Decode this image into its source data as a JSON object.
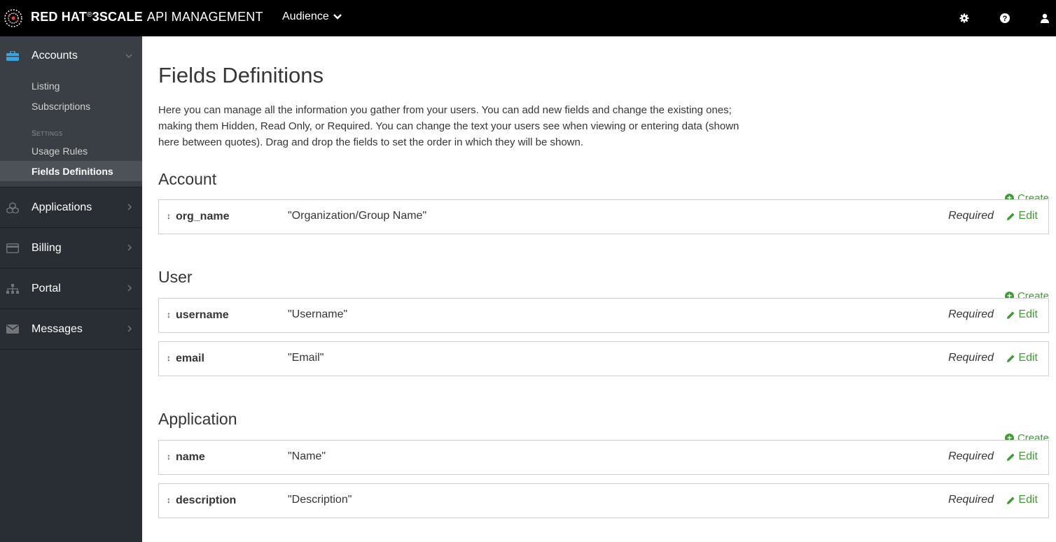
{
  "topbar": {
    "brand_bold": "RED HAT",
    "brand_reg": "®",
    "brand_bold2": "3SCALE",
    "brand_thin": "API MANAGEMENT",
    "audience_label": "Audience",
    "icons": [
      "gear-icon",
      "help-icon",
      "user-icon"
    ]
  },
  "sidebar": {
    "accounts": {
      "label": "Accounts",
      "items": [
        "Listing",
        "Subscriptions"
      ],
      "settings_label": "Settings",
      "settings_items": [
        "Usage Rules",
        "Fields Definitions"
      ],
      "active": "Fields Definitions"
    },
    "sections": [
      {
        "label": "Applications",
        "icon": "cubes-icon"
      },
      {
        "label": "Billing",
        "icon": "credit-card-icon"
      },
      {
        "label": "Portal",
        "icon": "sitemap-icon"
      },
      {
        "label": "Messages",
        "icon": "envelope-icon"
      }
    ]
  },
  "main": {
    "title": "Fields Definitions",
    "intro": "Here you can manage all the information you gather from your users. You can add new fields and change the existing ones; making them Hidden, Read Only, or Required. You can change the text your users see when viewing or entering data (shown here between quotes). Drag and drop the fields to set the order in which they will be shown.",
    "create_label": "Create",
    "edit_label": "Edit",
    "sections": [
      {
        "title": "Account",
        "fields": [
          {
            "name": "org_name",
            "label": "\"Organization/Group Name\"",
            "status": "Required"
          }
        ]
      },
      {
        "title": "User",
        "fields": [
          {
            "name": "username",
            "label": "\"Username\"",
            "status": "Required"
          },
          {
            "name": "email",
            "label": "\"Email\"",
            "status": "Required"
          }
        ]
      },
      {
        "title": "Application",
        "fields": [
          {
            "name": "name",
            "label": "\"Name\"",
            "status": "Required"
          },
          {
            "name": "description",
            "label": "\"Description\"",
            "status": "Required"
          }
        ]
      }
    ]
  }
}
